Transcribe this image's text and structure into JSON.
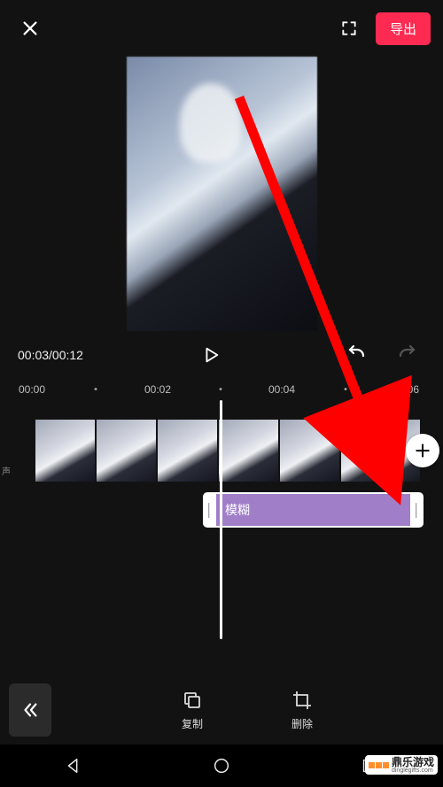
{
  "topbar": {
    "export_label": "导出"
  },
  "transport": {
    "timecode": "00:03/00:12"
  },
  "ruler": {
    "t0": "00:00",
    "t1": "00:02",
    "t2": "00:04",
    "t3": "00:06"
  },
  "timeline": {
    "mute_caption": "声",
    "effect_label": "模糊"
  },
  "toolbar": {
    "copy_label": "复制",
    "delete_label": "删除"
  },
  "watermark": {
    "cn": "鼎乐游戏",
    "en": "dinglegifts.com"
  },
  "icons": {
    "close": "close-icon",
    "fullscreen": "fullscreen-icon",
    "play": "play-icon",
    "undo": "undo-icon",
    "redo": "redo-icon",
    "plus": "plus-icon",
    "chevrons_left": "chevrons-left-icon",
    "copy": "copy-icon",
    "crop": "crop-icon",
    "nav_back": "nav-back-icon",
    "nav_home": "nav-home-icon",
    "nav_recent": "nav-recent-icon"
  }
}
